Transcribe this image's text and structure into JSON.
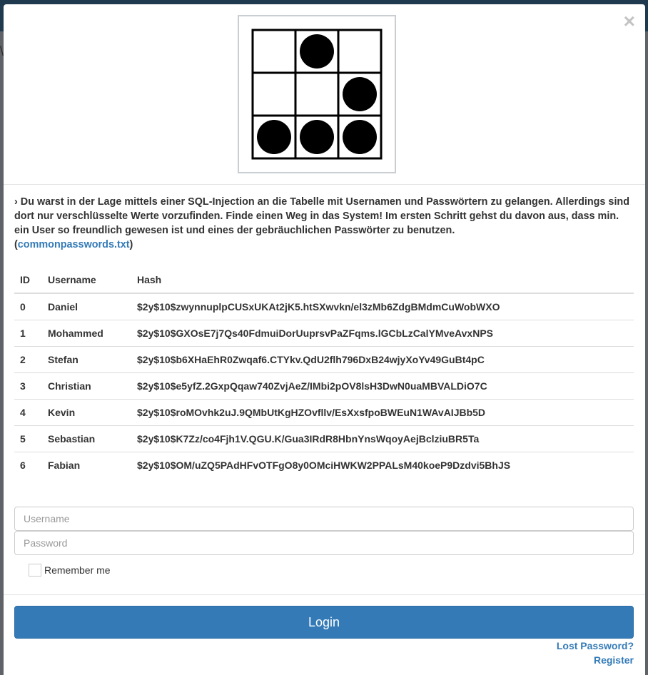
{
  "modal": {
    "close_symbol": "×",
    "logo_icon": "glider-icon"
  },
  "description": {
    "chevron": "›",
    "text": "Du warst in der Lage mittels einer SQL-Injection an die Tabelle mit Usernamen und Passwörtern zu gelangen. Allerdings sind dort nur verschlüsselte Werte vorzufinden. Finde einen Weg in das System! Im ersten Schritt gehst du davon aus, dass min. ein User so freundlich gewesen ist und eines der gebräuchlichen Passwörter zu benutzen.",
    "link_open": "(",
    "link_text": "commonpasswords.txt",
    "link_close": ")"
  },
  "table": {
    "headers": [
      "ID",
      "Username",
      "Hash"
    ],
    "rows": [
      {
        "id": "0",
        "username": "Daniel",
        "hash": "$2y$10$zwynnuplpCUSxUKAt2jK5.htSXwvkn/el3zMb6ZdgBMdmCuWobWXO"
      },
      {
        "id": "1",
        "username": "Mohammed",
        "hash": "$2y$10$GXOsE7j7Qs40FdmuiDorUuprsvPaZFqms.lGCbLzCalYMveAvxNPS"
      },
      {
        "id": "2",
        "username": "Stefan",
        "hash": "$2y$10$b6XHaEhR0Zwqaf6.CTYkv.QdU2flh796DxB24wjyXoYv49GuBt4pC"
      },
      {
        "id": "3",
        "username": "Christian",
        "hash": "$2y$10$e5yfZ.2GxpQqaw740ZvjAeZ/IMbi2pOV8lsH3DwN0uaMBVALDiO7C"
      },
      {
        "id": "4",
        "username": "Kevin",
        "hash": "$2y$10$roMOvhk2uJ.9QMbUtKgHZOvfllv/EsXxsfpoBWEuN1WAvAIJBb5D"
      },
      {
        "id": "5",
        "username": "Sebastian",
        "hash": "$2y$10$K7Zz/co4Fjh1V.QGU.K/Gua3IRdR8HbnYnsWqoyAejBclziuBR5Ta"
      },
      {
        "id": "6",
        "username": "Fabian",
        "hash": "$2y$10$OM/uZQ5PAdHFvOTFgO8y0OMciHWKW2PPALsM40koeP9Dzdvi5BhJS"
      }
    ]
  },
  "form": {
    "username_placeholder": "Username",
    "password_placeholder": "Password",
    "remember_label": "Remember me",
    "login_label": "Login",
    "lost_password_label": "Lost Password?",
    "register_label": "Register"
  },
  "colors": {
    "primary": "#337ab7",
    "topbar": "#1f3a4e",
    "overlay": "#5f6367"
  }
}
